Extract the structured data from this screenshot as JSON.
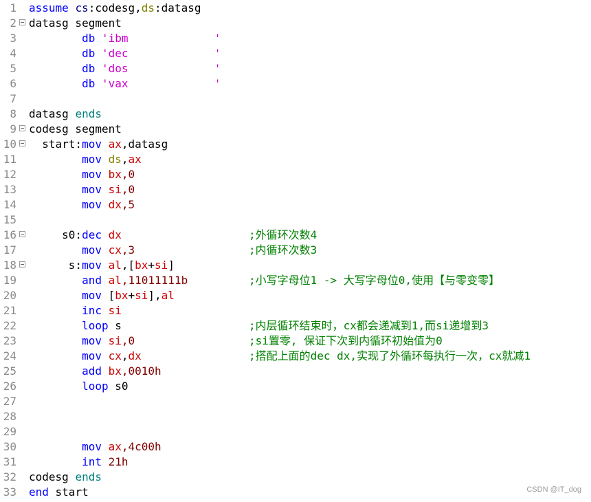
{
  "colors": {
    "keyword": "#0000ff",
    "identifier": "#000000",
    "register": "#cc0000",
    "instruction": "#0000ff",
    "string": "#cc00cc",
    "number": "#800000",
    "comment": "#008000",
    "ds_register": "#808000",
    "ends_keyword": "#008080",
    "line_number": "#8a8a8a"
  },
  "lines": [
    {
      "n": "1",
      "fold": false,
      "tokens": [
        [
          "assume",
          "#0000ff"
        ],
        [
          " ",
          "#000"
        ],
        [
          "cs",
          "#000080"
        ],
        [
          ":codesg,",
          "#000"
        ],
        [
          "ds",
          "#808000"
        ],
        [
          ":datasg",
          "#000"
        ]
      ]
    },
    {
      "n": "2",
      "fold": true,
      "tokens": [
        [
          "datasg segment",
          "#000"
        ]
      ]
    },
    {
      "n": "3",
      "fold": false,
      "tokens": [
        [
          "        ",
          "#000"
        ],
        [
          "db",
          "#0000ff"
        ],
        [
          " ",
          "#000"
        ],
        [
          "'ibm             '",
          "#cc00cc"
        ]
      ]
    },
    {
      "n": "4",
      "fold": false,
      "tokens": [
        [
          "        ",
          "#000"
        ],
        [
          "db",
          "#0000ff"
        ],
        [
          " ",
          "#000"
        ],
        [
          "'dec             '",
          "#cc00cc"
        ]
      ]
    },
    {
      "n": "5",
      "fold": false,
      "tokens": [
        [
          "        ",
          "#000"
        ],
        [
          "db",
          "#0000ff"
        ],
        [
          " ",
          "#000"
        ],
        [
          "'dos             '",
          "#cc00cc"
        ]
      ]
    },
    {
      "n": "6",
      "fold": false,
      "tokens": [
        [
          "        ",
          "#000"
        ],
        [
          "db",
          "#0000ff"
        ],
        [
          " ",
          "#000"
        ],
        [
          "'vax             '",
          "#cc00cc"
        ]
      ]
    },
    {
      "n": "7",
      "fold": false,
      "tokens": []
    },
    {
      "n": "8",
      "fold": false,
      "tokens": [
        [
          "datasg ",
          "#000"
        ],
        [
          "ends",
          "#008080"
        ]
      ]
    },
    {
      "n": "9",
      "fold": true,
      "tokens": [
        [
          "codesg segment",
          "#000"
        ]
      ]
    },
    {
      "n": "10",
      "fold": true,
      "tokens": [
        [
          "  start:",
          "#000"
        ],
        [
          "mov",
          "#0000ff"
        ],
        [
          " ",
          "#000"
        ],
        [
          "ax",
          "#cc0000"
        ],
        [
          ",datasg",
          "#000"
        ]
      ]
    },
    {
      "n": "11",
      "fold": false,
      "tokens": [
        [
          "        ",
          "#000"
        ],
        [
          "mov",
          "#0000ff"
        ],
        [
          " ",
          "#000"
        ],
        [
          "ds",
          "#808000"
        ],
        [
          ",",
          "#000"
        ],
        [
          "ax",
          "#cc0000"
        ]
      ]
    },
    {
      "n": "12",
      "fold": false,
      "tokens": [
        [
          "        ",
          "#000"
        ],
        [
          "mov",
          "#0000ff"
        ],
        [
          " ",
          "#000"
        ],
        [
          "bx",
          "#cc0000"
        ],
        [
          ",0",
          "#800000"
        ]
      ]
    },
    {
      "n": "13",
      "fold": false,
      "tokens": [
        [
          "        ",
          "#000"
        ],
        [
          "mov",
          "#0000ff"
        ],
        [
          " ",
          "#000"
        ],
        [
          "si",
          "#cc0000"
        ],
        [
          ",0",
          "#800000"
        ]
      ]
    },
    {
      "n": "14",
      "fold": false,
      "tokens": [
        [
          "        ",
          "#000"
        ],
        [
          "mov",
          "#0000ff"
        ],
        [
          " ",
          "#000"
        ],
        [
          "dx",
          "#cc0000"
        ],
        [
          ",5",
          "#800000"
        ]
      ]
    },
    {
      "n": "15",
      "fold": false,
      "tokens": []
    },
    {
      "n": "16",
      "fold": true,
      "tokens": [
        [
          "     s0:",
          "#000"
        ],
        [
          "dec",
          "#0000ff"
        ],
        [
          " ",
          "#000"
        ],
        [
          "dx",
          "#cc0000"
        ]
      ],
      "comment": ";外循环次数4"
    },
    {
      "n": "17",
      "fold": false,
      "tokens": [
        [
          "        ",
          "#000"
        ],
        [
          "mov",
          "#0000ff"
        ],
        [
          " ",
          "#000"
        ],
        [
          "cx",
          "#cc0000"
        ],
        [
          ",3",
          "#800000"
        ]
      ],
      "comment": ";内循环次数3"
    },
    {
      "n": "18",
      "fold": true,
      "tokens": [
        [
          "      s:",
          "#000"
        ],
        [
          "mov",
          "#0000ff"
        ],
        [
          " ",
          "#000"
        ],
        [
          "al",
          "#cc0000"
        ],
        [
          ",[",
          "#000"
        ],
        [
          "bx",
          "#cc0000"
        ],
        [
          "+",
          "#000"
        ],
        [
          "si",
          "#cc0000"
        ],
        [
          "]",
          "#000"
        ]
      ]
    },
    {
      "n": "19",
      "fold": false,
      "tokens": [
        [
          "        ",
          "#000"
        ],
        [
          "and",
          "#0000ff"
        ],
        [
          " ",
          "#000"
        ],
        [
          "al",
          "#cc0000"
        ],
        [
          ",11011111b",
          "#800000"
        ]
      ],
      "comment": ";小写字母位1 -> 大写字母位0,使用【与零变零】"
    },
    {
      "n": "20",
      "fold": false,
      "tokens": [
        [
          "        ",
          "#000"
        ],
        [
          "mov",
          "#0000ff"
        ],
        [
          " [",
          "#000"
        ],
        [
          "bx",
          "#cc0000"
        ],
        [
          "+",
          "#000"
        ],
        [
          "si",
          "#cc0000"
        ],
        [
          "],",
          "#000"
        ],
        [
          "al",
          "#cc0000"
        ]
      ]
    },
    {
      "n": "21",
      "fold": false,
      "tokens": [
        [
          "        ",
          "#000"
        ],
        [
          "inc",
          "#0000ff"
        ],
        [
          " ",
          "#000"
        ],
        [
          "si",
          "#cc0000"
        ]
      ]
    },
    {
      "n": "22",
      "fold": false,
      "tokens": [
        [
          "        ",
          "#000"
        ],
        [
          "loop",
          "#0000ff"
        ],
        [
          " s",
          "#000"
        ]
      ],
      "comment": ";内层循环结束时，cx都会递减到1,而si递增到3"
    },
    {
      "n": "23",
      "fold": false,
      "tokens": [
        [
          "        ",
          "#000"
        ],
        [
          "mov",
          "#0000ff"
        ],
        [
          " ",
          "#000"
        ],
        [
          "si",
          "#cc0000"
        ],
        [
          ",0",
          "#800000"
        ]
      ],
      "comment": ";si置零, 保证下次到内循环初始值为0"
    },
    {
      "n": "24",
      "fold": false,
      "tokens": [
        [
          "        ",
          "#000"
        ],
        [
          "mov",
          "#0000ff"
        ],
        [
          " ",
          "#000"
        ],
        [
          "cx",
          "#cc0000"
        ],
        [
          ",",
          "#000"
        ],
        [
          "dx",
          "#cc0000"
        ]
      ],
      "comment": ";搭配上面的dec dx,实现了外循环每执行一次，cx就减1"
    },
    {
      "n": "25",
      "fold": false,
      "tokens": [
        [
          "        ",
          "#000"
        ],
        [
          "add",
          "#0000ff"
        ],
        [
          " ",
          "#000"
        ],
        [
          "bx",
          "#cc0000"
        ],
        [
          ",0010h",
          "#800000"
        ]
      ]
    },
    {
      "n": "26",
      "fold": false,
      "tokens": [
        [
          "        ",
          "#000"
        ],
        [
          "loop",
          "#0000ff"
        ],
        [
          " s0",
          "#000"
        ]
      ]
    },
    {
      "n": "27",
      "fold": false,
      "tokens": []
    },
    {
      "n": "28",
      "fold": false,
      "tokens": []
    },
    {
      "n": "29",
      "fold": false,
      "tokens": []
    },
    {
      "n": "30",
      "fold": false,
      "tokens": [
        [
          "        ",
          "#000"
        ],
        [
          "mov",
          "#0000ff"
        ],
        [
          " ",
          "#000"
        ],
        [
          "ax",
          "#cc0000"
        ],
        [
          ",4c00h",
          "#800000"
        ]
      ]
    },
    {
      "n": "31",
      "fold": false,
      "tokens": [
        [
          "        ",
          "#000"
        ],
        [
          "int",
          "#0000ff"
        ],
        [
          " 21h",
          "#800000"
        ]
      ]
    },
    {
      "n": "32",
      "fold": false,
      "tokens": [
        [
          "codesg ",
          "#000"
        ],
        [
          "ends",
          "#008080"
        ]
      ]
    },
    {
      "n": "33",
      "fold": false,
      "tokens": [
        [
          "end",
          "#0000ff"
        ],
        [
          " start",
          "#000"
        ]
      ]
    }
  ],
  "watermark": "CSDN @IT_dog"
}
